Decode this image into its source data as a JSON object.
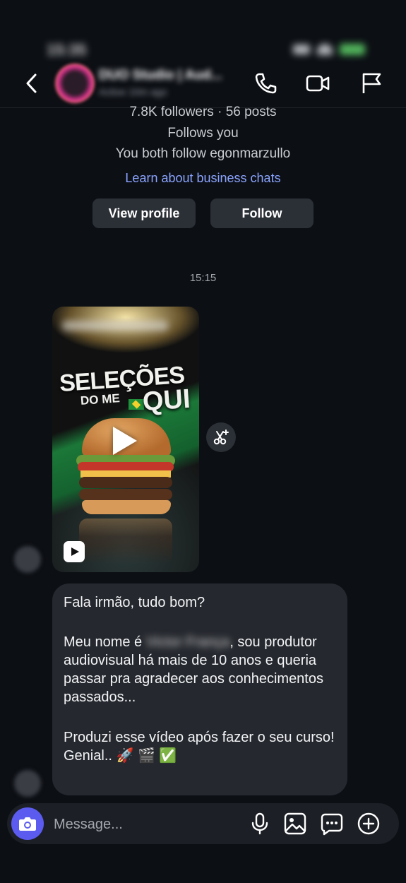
{
  "status_bar": {
    "time": "15:35"
  },
  "header": {
    "name": "DUO Studio | Aud...",
    "subtitle": "Active 10m ago"
  },
  "profile": {
    "stats": "7.8K followers · 56 posts",
    "follows_you": "Follows you",
    "mutual": "You both follow egonmarzullo",
    "learn_link": "Learn about business chats",
    "view_profile_label": "View profile",
    "follow_label": "Follow"
  },
  "thread": {
    "timestamp": "15:15",
    "video": {
      "title_top": "SELEÇÕES",
      "title_bottom_left": "DO ME",
      "title_bottom_right": "QUI"
    },
    "message": {
      "line1": "Fala irmão, tudo bom?",
      "para2_prefix": "Meu nome é ",
      "para2_redacted": "Victor França",
      "para2_suffix": ", sou produtor audiovisual há mais de 10 anos e queria passar pra agradecer aos conhecimentos passados...",
      "para3_line1": "Produzi esse vídeo após fazer o seu curso!",
      "para3_line2": "Genial.. 🚀 🎬 ✅"
    }
  },
  "composer": {
    "placeholder": "Message..."
  },
  "icons": {
    "back": "chevron-left-icon",
    "call": "phone-icon",
    "video_call": "video-camera-icon",
    "report": "flag-icon",
    "camera": "camera-icon",
    "mic": "microphone-icon",
    "gallery": "image-icon",
    "sticker": "chat-bubble-icon",
    "plus": "plus-circle-icon"
  },
  "colors": {
    "background": "#0c0f14",
    "bubble": "#25282e",
    "link": "#8ba4ff",
    "camera_button": "#5b5bf0"
  }
}
